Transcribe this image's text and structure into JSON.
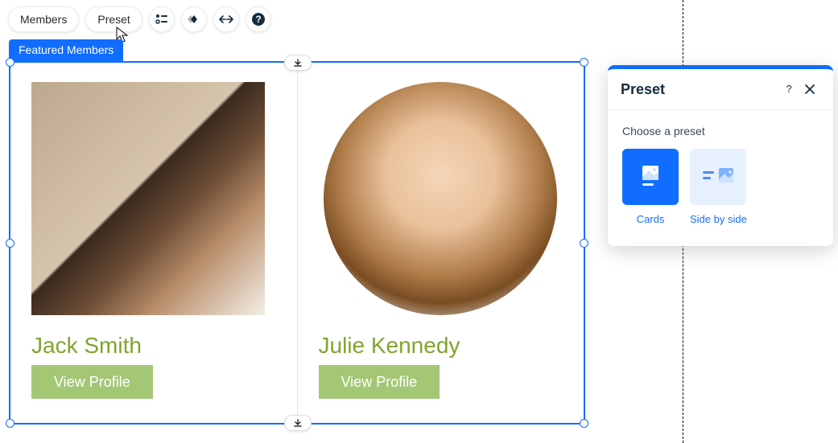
{
  "toolbar": {
    "members_label": "Members",
    "preset_label": "Preset",
    "icons": [
      "settings-list",
      "animation",
      "stretch",
      "help"
    ]
  },
  "selection": {
    "label": "Featured Members"
  },
  "cards": [
    {
      "name": "Jack Smith",
      "button": "View Profile"
    },
    {
      "name": "Julie Kennedy",
      "button": "View Profile"
    }
  ],
  "panel": {
    "title": "Preset",
    "subtitle": "Choose a preset",
    "options": [
      {
        "key": "cards",
        "label": "Cards",
        "active": true
      },
      {
        "key": "side_by_side",
        "label": "Side by side",
        "active": false
      }
    ]
  },
  "colors": {
    "primary": "#116dff",
    "accent_green": "#7fa52c",
    "button_green": "#a4c776"
  }
}
